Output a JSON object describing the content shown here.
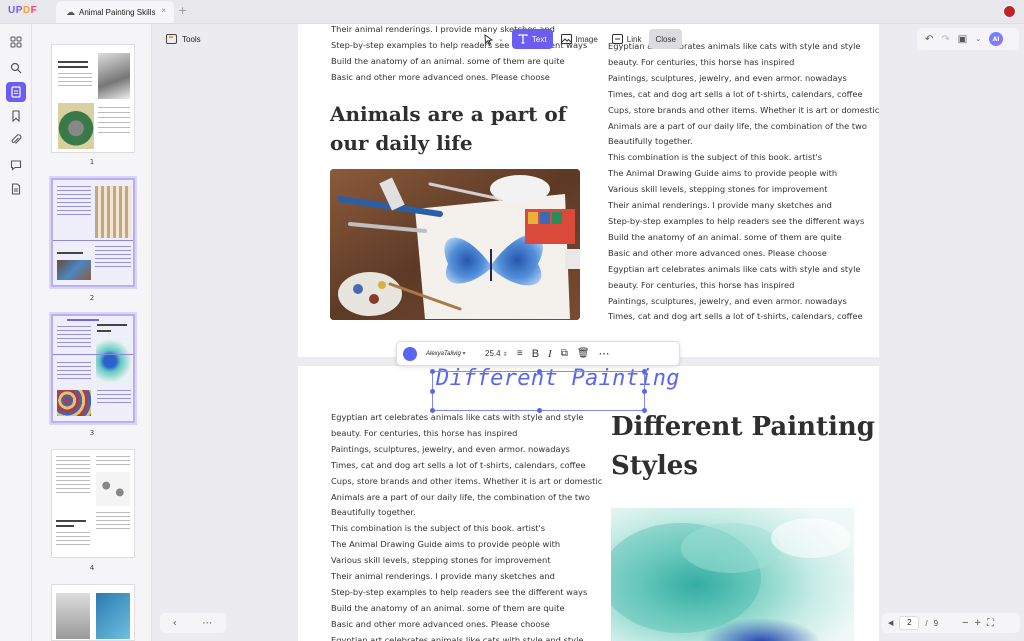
{
  "app": {
    "logo_parts": [
      "U",
      "P",
      "D",
      "F"
    ]
  },
  "tab": {
    "title": "Animal Painting Skills",
    "close": "×",
    "new": "+"
  },
  "toolbar": {
    "tools_label": "Tools"
  },
  "edit_bar": {
    "text_label": "Text",
    "image_label": "Image",
    "link_label": "Link",
    "close_label": "Close"
  },
  "thumbnails": [
    {
      "num": "1"
    },
    {
      "num": "2"
    },
    {
      "num": "3"
    },
    {
      "num": "4"
    }
  ],
  "page1": {
    "left_top_lines": [
      "Their animal renderings. I provide many sketches and",
      "Step-by-step examples to help readers see the different ways",
      "Build the anatomy of an animal. some of them are quite",
      "Basic and other more advanced ones. Please choose"
    ],
    "heading_line1": "Animals are a part of",
    "heading_line2": "our daily life",
    "right_lines": [
      "Egyptian art celebrates animals like cats with style and style",
      "beauty. For centuries, this horse has inspired",
      "Paintings, sculptures, jewelry, and even armor. nowadays",
      "Times, cat and dog art sells a lot of t-shirts, calendars, coffee",
      "Cups, store brands and other items. Whether it is art or domestic",
      "Animals are a part of our daily life, the combination of the two",
      "Beautifully together.",
      "This combination is the subject of this book. artist's",
      "The Animal Drawing Guide aims to provide people with",
      "Various skill levels, stepping stones for improvement",
      "Their animal renderings. I provide many sketches and",
      "Step-by-step examples to help readers see the different ways",
      "Build the anatomy of an animal. some of them are quite",
      "Basic and other more advanced ones. Please choose",
      "Egyptian art celebrates animals like cats with style and style",
      "beauty. For centuries, this horse has inspired",
      "Paintings, sculptures, jewelry, and even armor. nowadays",
      "Times, cat and dog art sells a lot of t-shirts, calendars, coffee"
    ]
  },
  "format_bar": {
    "color": "#5864f2",
    "font": "AlexyaTalivig",
    "size": "25.4"
  },
  "selected_text": "Different Painting",
  "page2": {
    "left_lines": [
      "Egyptian art celebrates animals like cats with style and style",
      "beauty. For centuries, this horse has inspired",
      "Paintings, sculptures, jewelry, and even armor. nowadays",
      "Times, cat and dog art sells a lot of t-shirts, calendars, coffee",
      "Cups, store brands and other items. Whether it is art or domestic",
      "Animals are a part of our daily life, the combination of the two",
      "Beautifully together.",
      "This combination is the subject of this book. artist's",
      "The Animal Drawing Guide aims to provide people with",
      "Various skill levels, stepping stones for improvement",
      "Their animal renderings. I provide many sketches and",
      "Step-by-step examples to help readers see the different ways",
      "Build the anatomy of an animal. some of them are quite",
      "Basic and other more advanced ones. Please choose",
      "Egyptian art celebrates animals like cats with style and style"
    ],
    "heading_line1": "Different Painting",
    "heading_line2": "Styles"
  },
  "pager": {
    "current": "2",
    "separator": "/",
    "total": "9"
  },
  "colors": {
    "accent": "#6b5cf2",
    "selection": "#5b66ef"
  }
}
